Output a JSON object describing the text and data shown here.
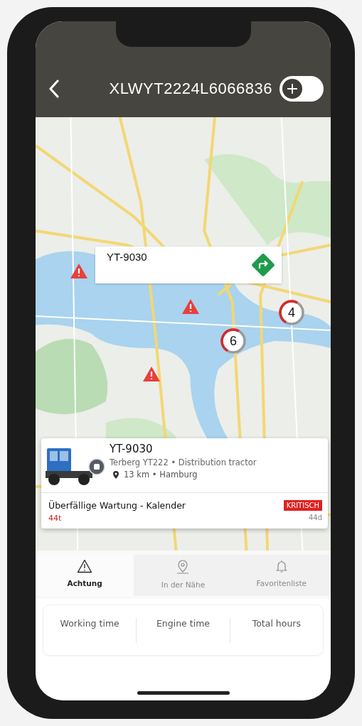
{
  "header": {
    "title": "XLWYT2224L6066836",
    "toggle": {
      "on": false
    }
  },
  "map": {
    "callout": {
      "title": "YT-9030"
    },
    "warnings": [
      {
        "kind": "warning"
      },
      {
        "kind": "warning"
      },
      {
        "kind": "warning"
      }
    ],
    "clusters": [
      {
        "count": "6"
      },
      {
        "count": "4"
      }
    ]
  },
  "vehicle_card": {
    "name": "YT-9030",
    "model": "Terberg YT222 • Distribution tractor",
    "location": "13 km • Hamburg",
    "alert": {
      "title": "Überfällige Wartung - Kalender",
      "value": "44t",
      "badge": "KRITISCH",
      "age": "44d"
    }
  },
  "tabs": [
    {
      "label": "Achtung",
      "kind": "warning",
      "selected": true
    },
    {
      "label": "In der Nähe",
      "kind": "pin",
      "selected": false
    },
    {
      "label": "Favoritenliste",
      "kind": "bell",
      "selected": false
    }
  ],
  "stats": [
    {
      "label": "Working time"
    },
    {
      "label": "Engine time"
    },
    {
      "label": "Total hours"
    }
  ]
}
